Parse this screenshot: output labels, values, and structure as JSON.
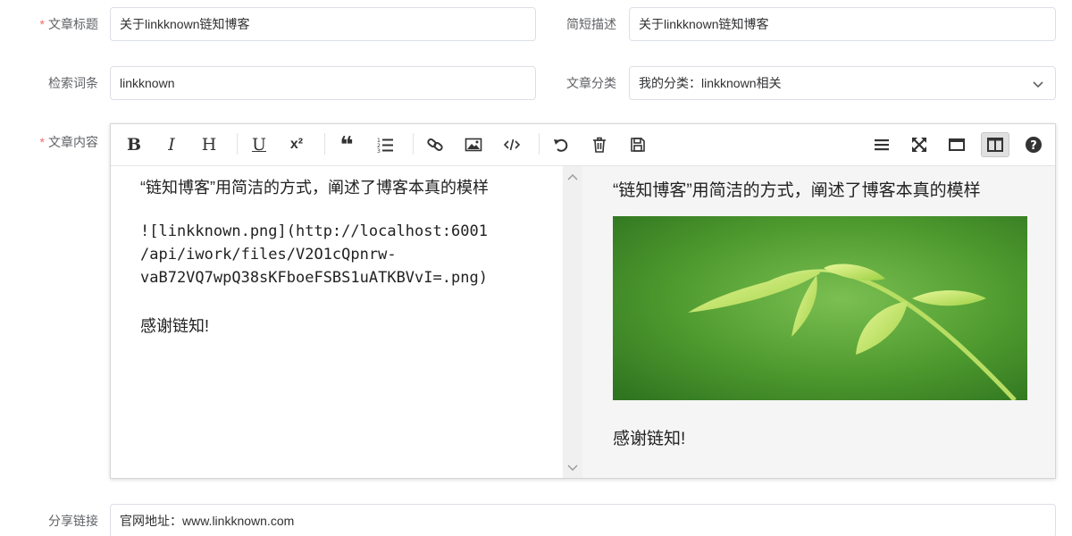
{
  "form": {
    "title_label": "文章标题",
    "title_value": "关于linkknown链知博客",
    "desc_label": "简短描述",
    "desc_value": "关于linkknown链知博客",
    "keywords_label": "检索词条",
    "keywords_value": "linkknown",
    "category_label": "文章分类",
    "category_value": "我的分类：linkknown相关",
    "content_label": "文章内容",
    "share_label": "分享链接",
    "share_value": "官网地址：www.linkknown.com",
    "required_mark": "*"
  },
  "toolbar": {
    "bold": "B",
    "italic": "I",
    "heading": "H",
    "underline": "U",
    "superscript": "x²",
    "quote": "❝"
  },
  "editor": {
    "code_lines": [
      "“链知博客”用简洁的方式，阐述了博客本真的模样",
      "![linkknown.png](http://localhost:6001",
      "/api/iwork/files/V2O1cQpnrw-",
      "vaB72VQ7wpQ38sKFboeFSBS1uATKBVvI=.png)",
      "感谢链知!"
    ],
    "preview_lines": [
      "“链知博客”用简洁的方式，阐述了博客本真的模样",
      "感谢链知!"
    ]
  },
  "colors": {
    "required": "#f56c6c",
    "label": "#606266",
    "border": "#dcdfe6",
    "preview_bg": "#f5f5f5"
  }
}
